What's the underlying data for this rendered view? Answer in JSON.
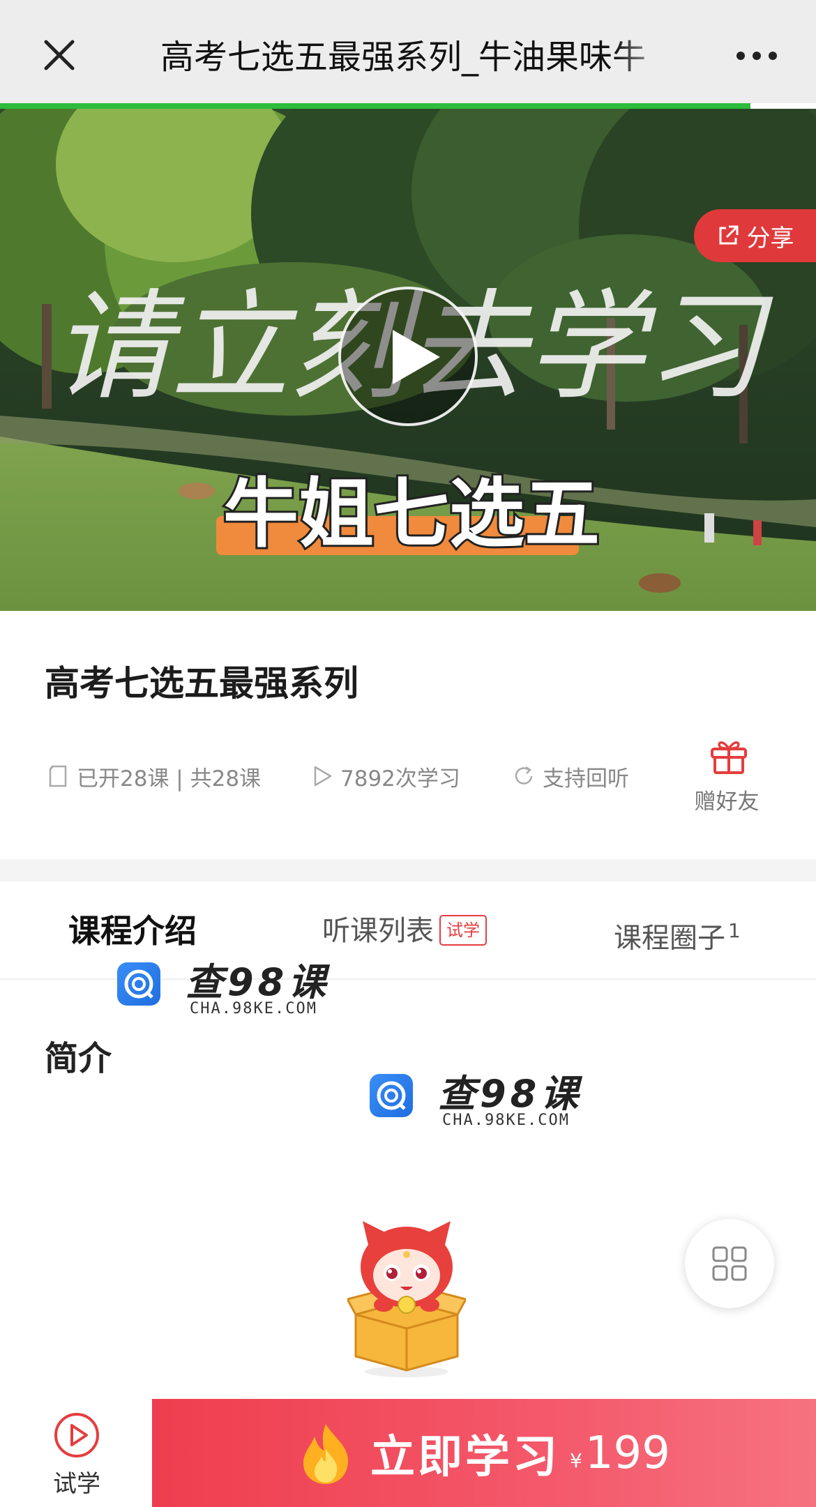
{
  "header": {
    "title": "高考七选五最强系列_牛油果味牛",
    "close_icon": "close-icon",
    "more_icon": "more-dots-icon",
    "load_progress": 0.92
  },
  "cover": {
    "calligraphy_text": "请立刻去学习",
    "banner_text": "牛姐七选五",
    "share_label": "分享",
    "share_icon": "external-share-icon",
    "play_icon": "play-icon"
  },
  "course": {
    "title": "高考七选五最强系列",
    "lessons": "已开28课 | 共28课",
    "study_count": "7892次学习",
    "replay": "支持回听",
    "gift_label": "赠好友"
  },
  "tabs": {
    "intro": "课程介绍",
    "list": "听课列表",
    "list_badge": "试学",
    "circle": "课程圈子",
    "circle_count": "1"
  },
  "watermark": {
    "big": "查98课",
    "small": "CHA.98KE.COM"
  },
  "section": {
    "heading": "简介"
  },
  "bottom": {
    "trial_label": "试学",
    "study_label": "立即学习",
    "price_symbol": "¥",
    "price_value": "199"
  },
  "colors": {
    "accent_red": "#e53d3f",
    "progress_green": "#2dbc3c",
    "cta_gradient_start": "#ee3e4e",
    "cta_gradient_end": "#f6727f"
  }
}
